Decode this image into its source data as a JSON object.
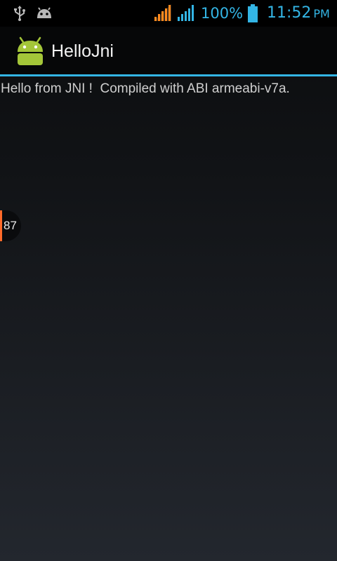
{
  "status_bar": {
    "icons": [
      "usb-icon",
      "android-debug-icon",
      "signal-orange-icon",
      "signal-blue-icon",
      "battery-icon"
    ],
    "battery_percent": "100%",
    "time": "11:52",
    "ampm": "PM",
    "accent_color": "#33b5e5",
    "signal_color_1": "#ff8a1e"
  },
  "action_bar": {
    "title": "HelloJni",
    "icon": "android-robot-icon",
    "divider_color": "#33b5e5"
  },
  "content": {
    "message": "Hello from JNI !  Compiled with ABI armeabi-v7a."
  },
  "scroll_indicator": {
    "value": "87",
    "accent_color": "#ff6a2a"
  }
}
